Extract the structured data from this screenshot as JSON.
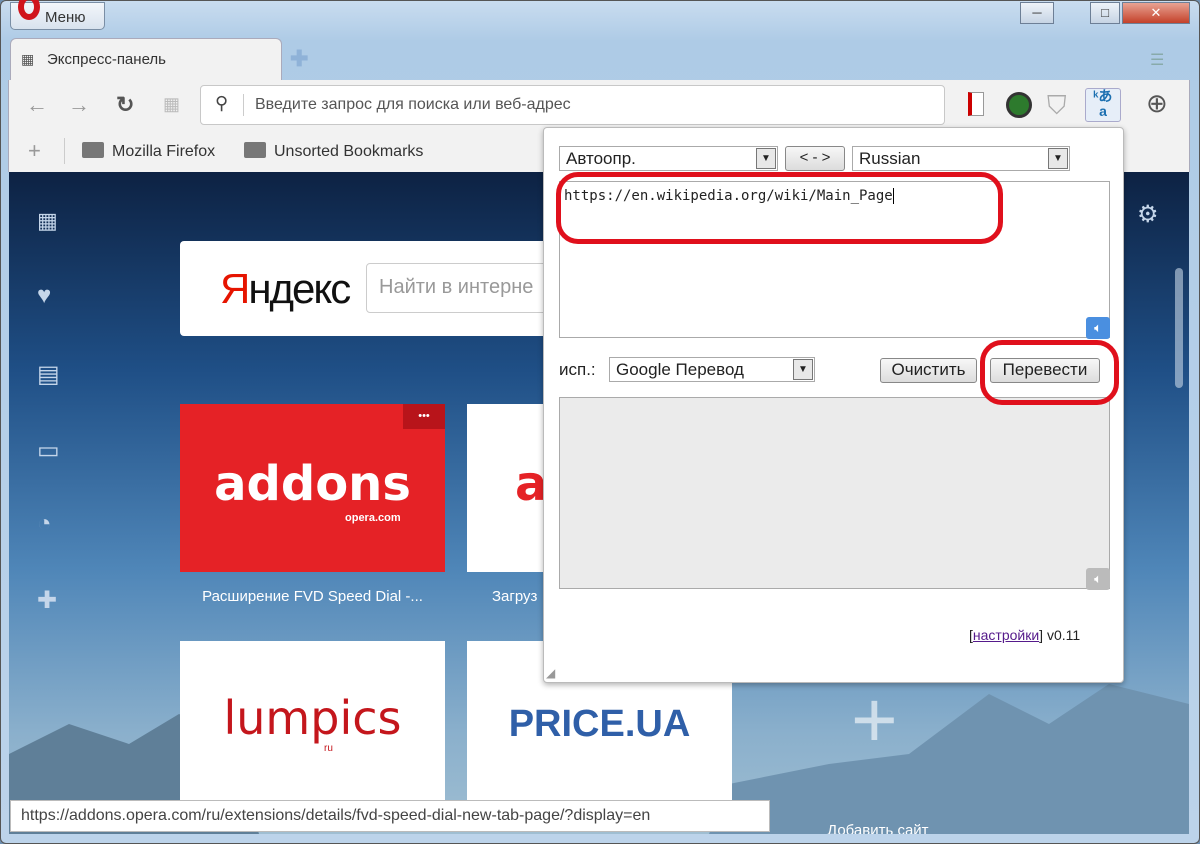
{
  "titlebar": {
    "menu_label": "Меню",
    "min": "─",
    "max": "□",
    "close": "✕"
  },
  "tabs": [
    {
      "label": "Экспресс-панель",
      "icon": "grid-icon"
    }
  ],
  "toolbar": {
    "address_placeholder": "Введите запрос для поиска или веб-адрес"
  },
  "bookmarks": [
    {
      "label": "Mozilla Firefox"
    },
    {
      "label": "Unsorted Bookmarks"
    }
  ],
  "yandex": {
    "logo_first": "Я",
    "logo_rest": "ндекс",
    "search_placeholder": "Найти в интерне"
  },
  "tiles": [
    {
      "logo": "addons",
      "sub": "opera.com",
      "label": "Расширение FVD Speed Dial -...",
      "menu": "•••"
    },
    {
      "logo": "a",
      "label": "Загруз"
    },
    {
      "logo": "lumpics",
      "sub": "ru"
    },
    {
      "logo": "PRICE.UA"
    }
  ],
  "add_site_label": "Добавить сайт",
  "translator": {
    "source_lang": "Автоопр.",
    "swap_label": "< - >",
    "target_lang": "Russian",
    "input_text": "https://en.wikipedia.org/wiki/Main_Page",
    "engine_label": "исп.:",
    "engine": "Google Перевод",
    "clear_label": "Очистить",
    "translate_label": "Перевести",
    "settings_link": "настройки",
    "version": "v0.11"
  },
  "status_url": "https://addons.opera.com/ru/extensions/details/fvd-speed-dial-new-tab-page/?display=en",
  "colors": {
    "annotation": "#e0101c",
    "opera_red": "#e52226",
    "speaker_active": "#4a8fe0"
  }
}
